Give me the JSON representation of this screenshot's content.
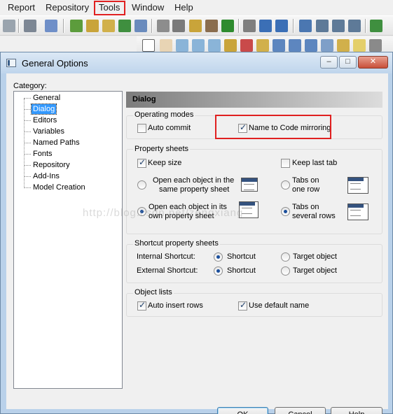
{
  "menubar": {
    "items": [
      "Report",
      "Repository",
      "Tools",
      "Window",
      "Help"
    ],
    "highlighted": "Tools"
  },
  "dialog": {
    "title": "General Options",
    "category_label": "Category:",
    "categories": [
      "General",
      "Dialog",
      "Editors",
      "Variables",
      "Named Paths",
      "Fonts",
      "Repository",
      "Add-Ins",
      "Model Creation"
    ],
    "selected_category": "Dialog",
    "page_title": "Dialog",
    "operating_modes": {
      "title": "Operating modes",
      "auto_commit": {
        "label": "Auto commit",
        "checked": false
      },
      "name_to_code": {
        "label": "Name to Code mirroring",
        "checked": true
      }
    },
    "property_sheets": {
      "title": "Property sheets",
      "keep_size": {
        "label": "Keep size",
        "checked": true
      },
      "keep_last_tab": {
        "label": "Keep last tab",
        "checked": false
      },
      "open_same": {
        "line1": "Open each object in the",
        "line2": "same property sheet",
        "selected": false
      },
      "open_own": {
        "line1": "Open each object in its",
        "line2": "own property sheet",
        "selected": true
      },
      "tabs_one_row": {
        "line1": "Tabs on",
        "line2": "one row",
        "selected": false
      },
      "tabs_several_rows": {
        "line1": "Tabs on",
        "line2": "several rows",
        "selected": true
      }
    },
    "shortcut_sheets": {
      "title": "Shortcut property sheets",
      "internal_label": "Internal Shortcut:",
      "external_label": "External Shortcut:",
      "shortcut_option": "Shortcut",
      "target_option": "Target object",
      "internal_selected": "Shortcut",
      "external_selected": "Shortcut"
    },
    "object_lists": {
      "title": "Object lists",
      "auto_insert_rows": {
        "label": "Auto insert rows",
        "checked": true
      },
      "use_default_name": {
        "label": "Use default name",
        "checked": true
      }
    },
    "buttons": {
      "ok": "OK",
      "cancel": "Cancel",
      "help": "Help"
    }
  },
  "watermark": "http://blog.csdn.net/zengxiang",
  "colors": {
    "highlight_red": "#e02020",
    "selection_blue": "#3399ff"
  }
}
